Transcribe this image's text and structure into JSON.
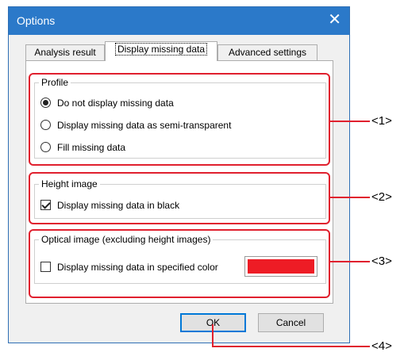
{
  "window": {
    "title": "Options",
    "close_glyph": "✕"
  },
  "tabs": [
    {
      "label": "Analysis result",
      "active": false
    },
    {
      "label": "Display missing data",
      "active": true
    },
    {
      "label": "Advanced settings",
      "active": false
    }
  ],
  "profile": {
    "legend": "Profile",
    "options": [
      {
        "label": "Do not display missing data",
        "selected": true
      },
      {
        "label": "Display missing data as semi-transparent",
        "selected": false
      },
      {
        "label": "Fill missing data",
        "selected": false
      }
    ]
  },
  "height_image": {
    "legend": "Height image",
    "checkbox_label": "Display missing data in black",
    "checked": true
  },
  "optical_image": {
    "legend": "Optical image (excluding height images)",
    "checkbox_label": "Display missing data in specified color",
    "checked": false,
    "color": "#ee1c25"
  },
  "buttons": {
    "ok": "OK",
    "cancel": "Cancel"
  },
  "callouts": [
    "<1>",
    "<2>",
    "<3>",
    "<4>"
  ],
  "colors": {
    "titlebar": "#2b79c9",
    "highlight": "#e0202e"
  }
}
